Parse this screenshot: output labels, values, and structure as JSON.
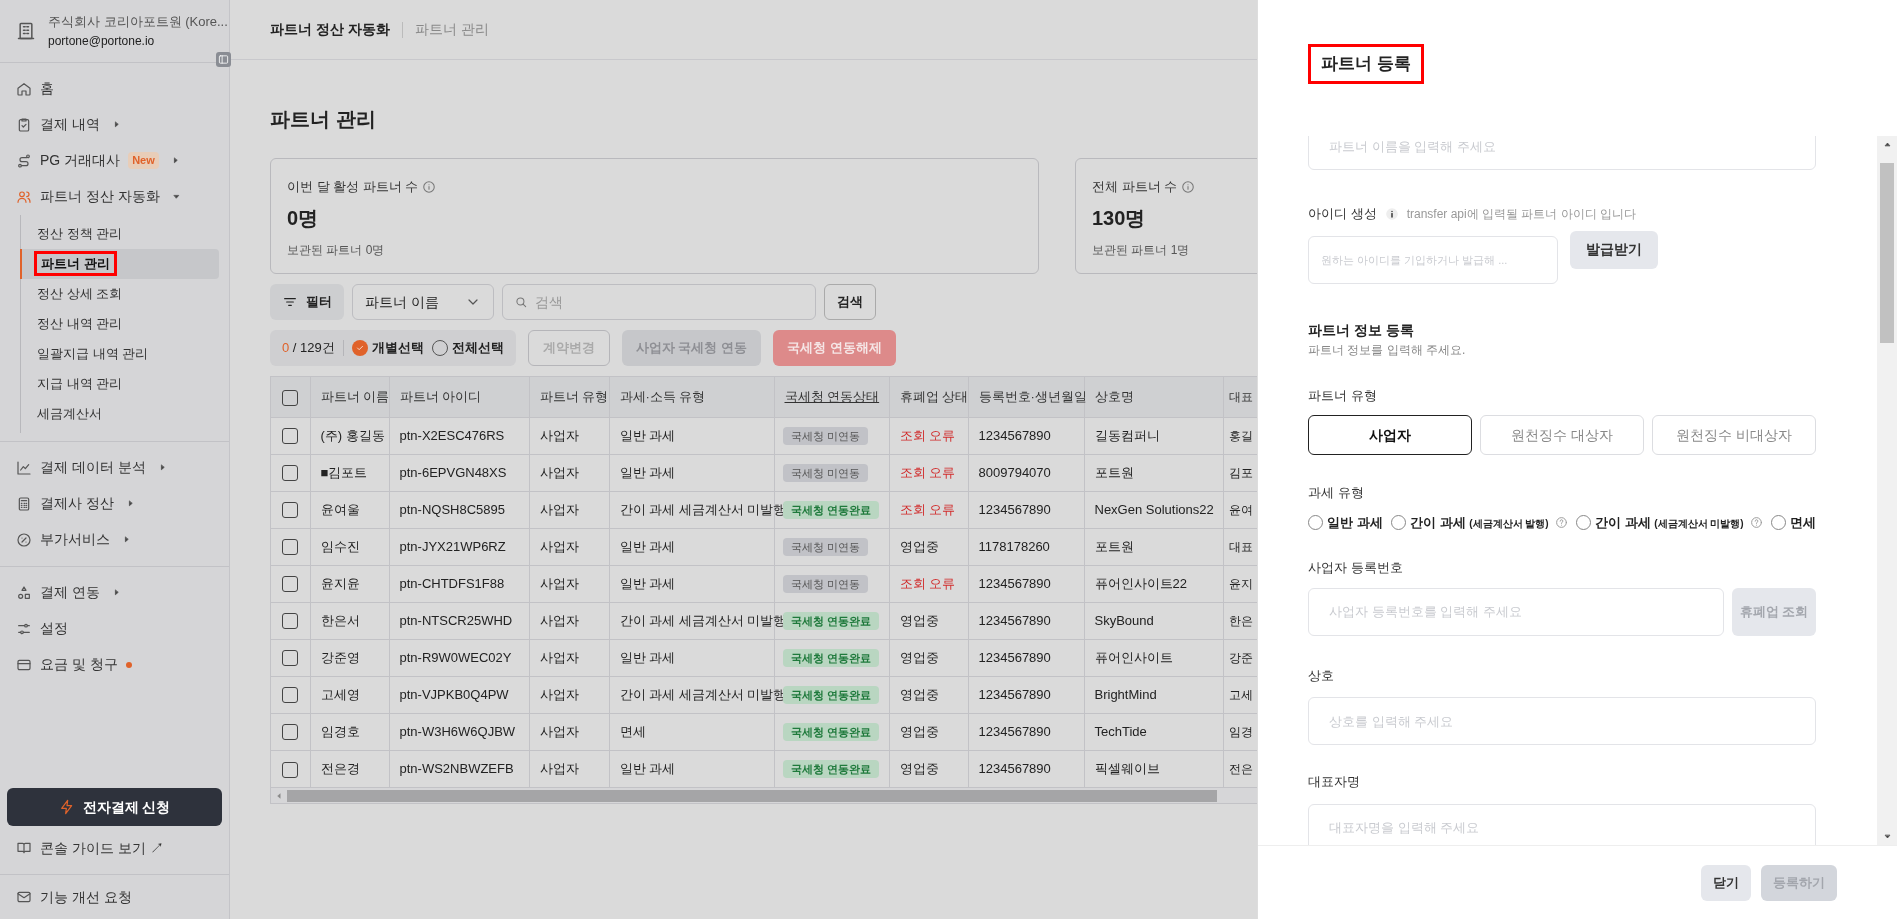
{
  "sidebar": {
    "company": "주식회사 코리아포트원 (Kore...",
    "email": "portone@portone.io",
    "groups": [
      [
        {
          "kind": "link",
          "label": "홈",
          "dot": false
        },
        {
          "kind": "menu",
          "label": "결제 내역",
          "expanded": false,
          "dot": false
        },
        {
          "kind": "menu",
          "label": "PG 거래대사",
          "badge": "New",
          "expanded": false,
          "dot": false
        },
        {
          "kind": "menu",
          "label": "파트너 정산 자동화",
          "expanded": true,
          "dot": false,
          "children": [
            {
              "label": "정산 정책 관리",
              "selected": false,
              "annotated": false
            },
            {
              "label": "파트너 관리",
              "selected": true,
              "annotated": true
            },
            {
              "label": "정산 상세 조회",
              "selected": false,
              "annotated": false
            },
            {
              "label": "정산 내역 관리",
              "selected": false,
              "annotated": false
            },
            {
              "label": "일괄지급 내역 관리",
              "selected": false,
              "annotated": false
            },
            {
              "label": "지급 내역 관리",
              "selected": false,
              "annotated": false
            },
            {
              "label": "세금계산서",
              "selected": false,
              "annotated": false
            }
          ]
        }
      ],
      [
        {
          "kind": "menu",
          "label": "결제 데이터 분석",
          "expanded": false,
          "dot": false
        },
        {
          "kind": "menu",
          "label": "결제사 정산",
          "expanded": false,
          "dot": false
        },
        {
          "kind": "menu",
          "label": "부가서비스",
          "expanded": false,
          "dot": false
        }
      ],
      [
        {
          "kind": "menu",
          "label": "결제 연동",
          "expanded": false,
          "dot": false
        },
        {
          "kind": "link",
          "label": "설정",
          "dot": false
        },
        {
          "kind": "link",
          "label": "요금 및 청구",
          "dot": true
        }
      ]
    ],
    "apply_button": "전자결제 신청",
    "guide_link": "콘솔 가이드 보기 ↗",
    "feedback": "기능 개선 요청"
  },
  "breadcrumb": [
    "파트너 정산 자동화",
    "파트너 관리"
  ],
  "page_title": "파트너 관리",
  "stat_cards": [
    {
      "label": "이번 달 활성 파트너 수",
      "value": "0명",
      "sub": "보관된 파트너 0명"
    },
    {
      "label": "전체 파트너 수",
      "value": "130명",
      "sub": "보관된 파트너 1명"
    }
  ],
  "toolbar": {
    "filter_button": "필터",
    "select": "파트너 이름",
    "search_placeholder": "검색",
    "search_button": "검색"
  },
  "selection": {
    "count": "0",
    "total": "/ 129건",
    "modes": [
      {
        "label": "개별선택",
        "selected": true
      },
      {
        "label": "전체선택",
        "selected": false
      }
    ],
    "actions": [
      {
        "kind": "outline",
        "label": "계약변경",
        "disabled": true
      },
      {
        "kind": "gray",
        "label": "사업자 국세청 연동",
        "disabled": true
      },
      {
        "kind": "danger",
        "label": "국세청 연동해제",
        "disabled": true
      }
    ]
  },
  "table": {
    "all_checked": false,
    "columns": [
      {
        "label": "파트너 이름",
        "underlined": false
      },
      {
        "label": "파트너 아이디",
        "underlined": false
      },
      {
        "label": "파트너 유형",
        "underlined": false
      },
      {
        "label": "과세·소득 유형",
        "underlined": false
      },
      {
        "label": "국세청 연동상태",
        "underlined": true
      },
      {
        "label": "휴폐업 상태",
        "underlined": false
      },
      {
        "label": "등록번호·생년월일",
        "underlined": false
      },
      {
        "label": "상호명",
        "underlined": false
      },
      {
        "label": "대표",
        "underlined": false
      }
    ],
    "rows": [
      {
        "checked": false,
        "name": "(주) 홍길동",
        "partner_id": "ptn-X2ESC476RS",
        "partner_type": "사업자",
        "tax_type": "일반 과세",
        "nts_status": {
          "label": "국세청 미연동",
          "linked": false
        },
        "business_status": {
          "label": "조회 오류",
          "error": true
        },
        "reg_no": "1234567890",
        "company": "길동컴퍼니",
        "column_10": "홍길"
      },
      {
        "checked": false,
        "name": "■김포트",
        "partner_id": "ptn-6EPVGN48XS",
        "partner_type": "사업자",
        "tax_type": "일반 과세",
        "nts_status": {
          "label": "국세청 미연동",
          "linked": false
        },
        "business_status": {
          "label": "조회 오류",
          "error": true
        },
        "reg_no": "8009794070",
        "company": "포트원",
        "column_10": "김포"
      },
      {
        "checked": false,
        "name": "윤여울",
        "partner_id": "ptn-NQSH8C5895",
        "partner_type": "사업자",
        "tax_type": "간이 과세 세금계산서 미발행",
        "nts_status": {
          "label": "국세청 연동완료",
          "linked": true
        },
        "business_status": {
          "label": "조회 오류",
          "error": true
        },
        "reg_no": "1234567890",
        "company": "NexGen Solutions22",
        "column_10": "윤여"
      },
      {
        "checked": false,
        "name": "임수진",
        "partner_id": "ptn-JYX21WP6RZ",
        "partner_type": "사업자",
        "tax_type": "일반 과세",
        "nts_status": {
          "label": "국세청 미연동",
          "linked": false
        },
        "business_status": {
          "label": "영업중",
          "error": false
        },
        "reg_no": "1178178260",
        "company": "포트원",
        "column_10": "대표"
      },
      {
        "checked": false,
        "name": "윤지윤",
        "partner_id": "ptn-CHTDFS1F88",
        "partner_type": "사업자",
        "tax_type": "일반 과세",
        "nts_status": {
          "label": "국세청 미연동",
          "linked": false
        },
        "business_status": {
          "label": "조회 오류",
          "error": true
        },
        "reg_no": "1234567890",
        "company": "퓨어인사이트22",
        "column_10": "윤지"
      },
      {
        "checked": false,
        "name": "한은서",
        "partner_id": "ptn-NTSCR25WHD",
        "partner_type": "사업자",
        "tax_type": "간이 과세 세금계산서 미발행",
        "nts_status": {
          "label": "국세청 연동완료",
          "linked": true
        },
        "business_status": {
          "label": "영업중",
          "error": false
        },
        "reg_no": "1234567890",
        "company": "SkyBound",
        "column_10": "한은"
      },
      {
        "checked": false,
        "name": "강준영",
        "partner_id": "ptn-R9W0WEC02Y",
        "partner_type": "사업자",
        "tax_type": "일반 과세",
        "nts_status": {
          "label": "국세청 연동완료",
          "linked": true
        },
        "business_status": {
          "label": "영업중",
          "error": false
        },
        "reg_no": "1234567890",
        "company": "퓨어인사이트",
        "column_10": "강준"
      },
      {
        "checked": false,
        "name": "고세영",
        "partner_id": "ptn-VJPKB0Q4PW",
        "partner_type": "사업자",
        "tax_type": "간이 과세 세금계산서 미발행",
        "nts_status": {
          "label": "국세청 연동완료",
          "linked": true
        },
        "business_status": {
          "label": "영업중",
          "error": false
        },
        "reg_no": "1234567890",
        "company": "BrightMind",
        "column_10": "고세"
      },
      {
        "checked": false,
        "name": "임경호",
        "partner_id": "ptn-W3H6W6QJBW",
        "partner_type": "사업자",
        "tax_type": "면세",
        "nts_status": {
          "label": "국세청 연동완료",
          "linked": true
        },
        "business_status": {
          "label": "영업중",
          "error": false
        },
        "reg_no": "1234567890",
        "company": "TechTide",
        "column_10": "임경"
      },
      {
        "checked": false,
        "name": "전은경",
        "partner_id": "ptn-WS2NBWZEFB",
        "partner_type": "사업자",
        "tax_type": "일반 과세",
        "nts_status": {
          "label": "국세청 연동완료",
          "linked": true
        },
        "business_status": {
          "label": "영업중",
          "error": false
        },
        "reg_no": "1234567890",
        "company": "픽셀웨이브",
        "column_10": "전은"
      }
    ]
  },
  "drawer": {
    "title": "파트너 등록",
    "title_annotated": true,
    "name_placeholder": "파트너 이름을 입력해 주세요",
    "id_label": "아이디 생성",
    "id_hint": "transfer api에 입력될 파트너 아이디 입니다",
    "id_placeholder": "원하는 아이디를 기입하거나 발급해 ...",
    "id_button": "발급받기",
    "section_title": "파트너 정보 등록",
    "section_sub": "파트너 정보를 입력해 주세요.",
    "type_label": "파트너 유형",
    "types": [
      {
        "label": "사업자",
        "selected": true
      },
      {
        "label": "원천징수 대상자",
        "selected": false
      },
      {
        "label": "원천징수 비대상자",
        "selected": false
      }
    ],
    "tax_label": "과세 유형",
    "tax_options": [
      {
        "label": "일반 과세",
        "help": false,
        "selected": false
      },
      {
        "label": "간이 과세",
        "note": "(세금계산서 발행)",
        "help": true,
        "selected": false
      },
      {
        "label": "간이 과세",
        "note": "(세금계산서 미발행)",
        "help": true,
        "selected": false
      },
      {
        "label": "면세",
        "help": false,
        "selected": false
      }
    ],
    "biz_label": "사업자 등록번호",
    "biz_placeholder": "사업자 등록번호를 입력해 주세요",
    "biz_button": {
      "label": "휴폐업 조회",
      "disabled": true
    },
    "company_label": "상호",
    "company_placeholder": "상호를 입력해 주세요",
    "rep_label": "대표자명",
    "rep_placeholder": "대표자명을 입력해 주세요",
    "footer_buttons": [
      {
        "label": "닫기",
        "disabled": false
      },
      {
        "label": "등록하기",
        "disabled": true
      }
    ]
  }
}
